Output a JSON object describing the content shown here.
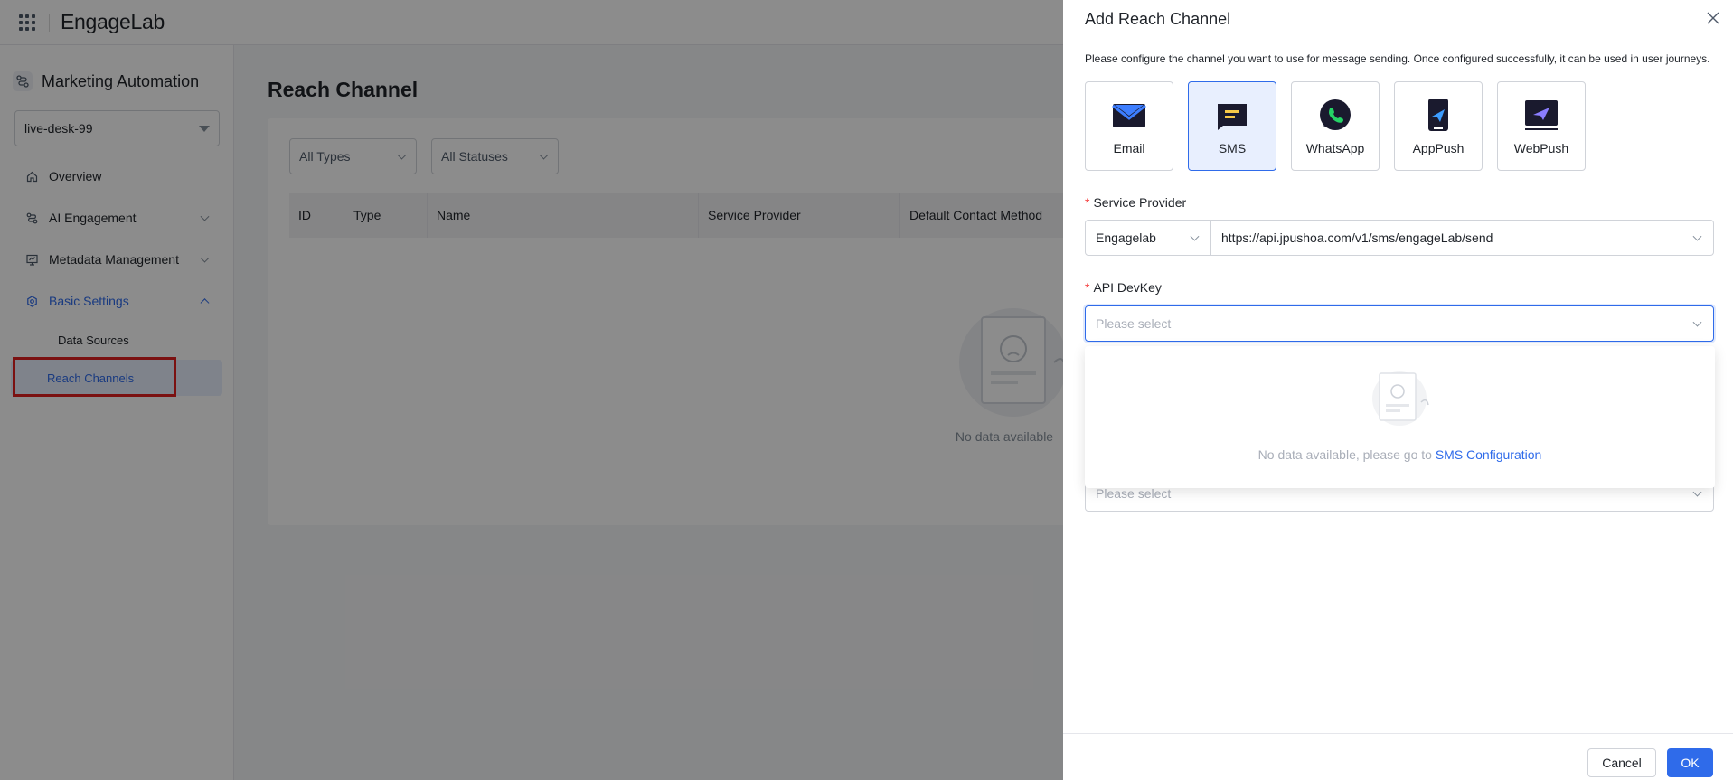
{
  "topbar": {
    "logo": "EngageLab",
    "apps_icon": "apps-grid-icon"
  },
  "sidebar": {
    "title": "Marketing Automation",
    "workspace": "live-desk-99",
    "items": [
      {
        "label": "Overview",
        "icon": "home-icon"
      },
      {
        "label": "AI Engagement",
        "icon": "ai-engagement-icon"
      },
      {
        "label": "Metadata Management",
        "icon": "metadata-icon"
      },
      {
        "label": "Basic Settings",
        "icon": "settings-icon"
      }
    ],
    "subitems": [
      {
        "label": "Data Sources"
      },
      {
        "label": "Reach Channels"
      }
    ]
  },
  "main": {
    "title": "Reach Channel",
    "filters": {
      "type": "All Types",
      "status": "All Statuses"
    },
    "table": {
      "columns": [
        "ID",
        "Type",
        "Name",
        "Service Provider",
        "Default Contact Method"
      ]
    },
    "empty_text": "No data available"
  },
  "drawer": {
    "title": "Add Reach Channel",
    "description": "Please configure the channel you want to use for message sending. Once configured successfully, it can be used in user journeys.",
    "channels": [
      {
        "label": "Email",
        "icon": "email-icon"
      },
      {
        "label": "SMS",
        "icon": "sms-icon"
      },
      {
        "label": "WhatsApp",
        "icon": "whatsapp-icon"
      },
      {
        "label": "AppPush",
        "icon": "apppush-icon"
      },
      {
        "label": "WebPush",
        "icon": "webpush-icon"
      }
    ],
    "selected_channel": "SMS",
    "service_provider": {
      "label": "Service Provider",
      "provider": "Engagelab",
      "url": "https://api.jpushoa.com/v1/sms/engageLab/send"
    },
    "api_devkey": {
      "label": "API DevKey",
      "placeholder": "Please select"
    },
    "dropdown": {
      "text": "No data available, please go to ",
      "link": "SMS Configuration"
    },
    "second_select_placeholder": "Please select",
    "cancel_label": "Cancel",
    "ok_label": "OK"
  },
  "colors": {
    "accent": "#2f6bea",
    "required": "#f53f3f",
    "highlight": "#e02020"
  }
}
